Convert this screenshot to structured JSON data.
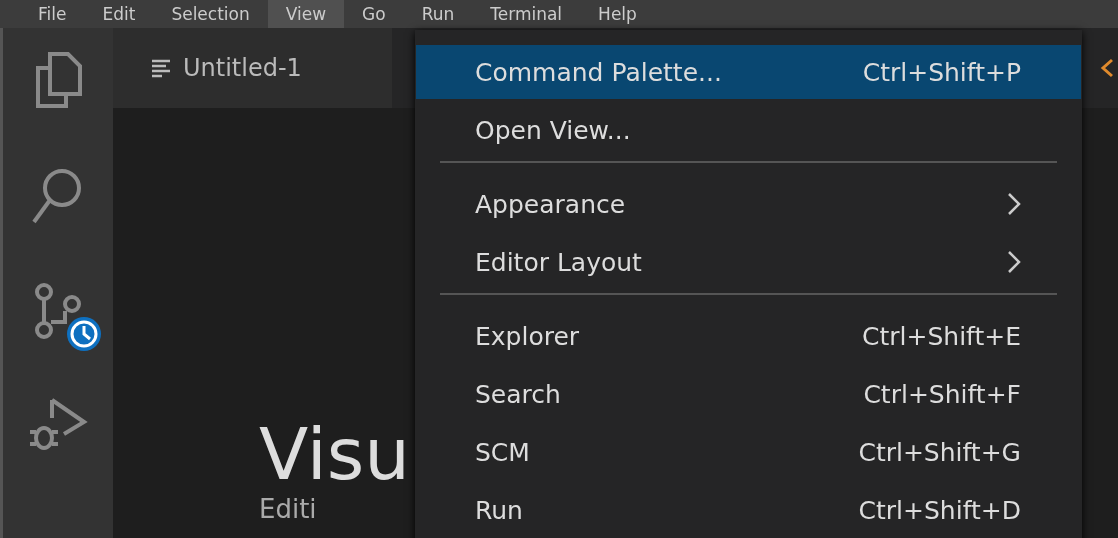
{
  "menubar": [
    {
      "label": "File",
      "selected": false
    },
    {
      "label": "Edit",
      "selected": false
    },
    {
      "label": "Selection",
      "selected": false
    },
    {
      "label": "View",
      "selected": true
    },
    {
      "label": "Go",
      "selected": false
    },
    {
      "label": "Run",
      "selected": false
    },
    {
      "label": "Terminal",
      "selected": false
    },
    {
      "label": "Help",
      "selected": false
    }
  ],
  "activity_bar": [
    {
      "badge": false
    },
    {
      "badge": false
    },
    {
      "badge": true
    },
    {
      "badge": false
    }
  ],
  "tabs": [
    {
      "label": "Untitled-1",
      "selected": true
    }
  ],
  "editor": {
    "title": "Visu",
    "subtitle": "Editi"
  },
  "view_menu": [
    {
      "kind": "item",
      "label": "Command Palette...",
      "shortcut": "Ctrl+Shift+P",
      "selected": true
    },
    {
      "kind": "item",
      "label": "Open View...",
      "selected": false
    },
    {
      "kind": "separator"
    },
    {
      "kind": "submenu",
      "label": "Appearance",
      "selected": false
    },
    {
      "kind": "submenu",
      "label": "Editor Layout",
      "selected": false
    },
    {
      "kind": "separator"
    },
    {
      "kind": "item",
      "label": "Explorer",
      "shortcut": "Ctrl+Shift+E",
      "selected": false
    },
    {
      "kind": "item",
      "label": "Search",
      "shortcut": "Ctrl+Shift+F",
      "selected": false
    },
    {
      "kind": "item",
      "label": "SCM",
      "shortcut": "Ctrl+Shift+G",
      "selected": false
    },
    {
      "kind": "item",
      "label": "Run",
      "shortcut": "Ctrl+Shift+D",
      "selected": false
    }
  ]
}
